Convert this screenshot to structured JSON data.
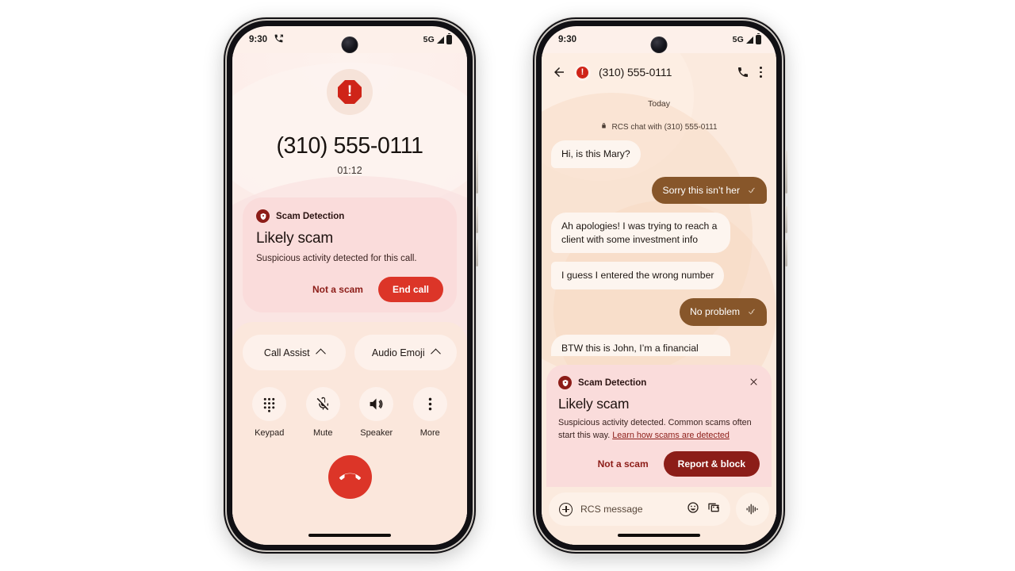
{
  "call_phone": {
    "status_bar": {
      "time": "9:30",
      "call_icon": "phone-in-talk-icon",
      "network": "5G",
      "signal_icon": "signal-bars-icon",
      "battery_icon": "battery-icon"
    },
    "caller": {
      "avatar_icon": "scam-octagon-icon",
      "number": "(310) 555-0111",
      "timer": "01:12"
    },
    "scam_card": {
      "badge_icon": "scam-shield-icon",
      "label": "Scam Detection",
      "title": "Likely scam",
      "body": "Suspicious activity detected for this call.",
      "secondary_action": "Not a scam",
      "primary_action": "End call",
      "bg_color": "#fadcdb",
      "primary_color": "#dc3528"
    },
    "assist_chips": [
      {
        "label": "Call Assist",
        "icon": "chevron-up-icon"
      },
      {
        "label": "Audio Emoji",
        "icon": "chevron-up-icon"
      }
    ],
    "controls": [
      {
        "label": "Keypad",
        "icon": "dialpad-icon"
      },
      {
        "label": "Mute",
        "icon": "mic-off-icon"
      },
      {
        "label": "Speaker",
        "icon": "speaker-icon"
      },
      {
        "label": "More",
        "icon": "more-vertical-icon"
      }
    ],
    "end_call": {
      "icon": "call-end-icon",
      "color": "#dc3528"
    }
  },
  "chat_phone": {
    "status_bar": {
      "time": "9:30",
      "network": "5G",
      "signal_icon": "signal-bars-icon",
      "battery_icon": "battery-icon"
    },
    "header": {
      "back_icon": "back-arrow-icon",
      "avatar_icon": "scam-alert-icon",
      "title": "(310) 555-0111",
      "call_icon": "phone-icon",
      "more_icon": "more-vertical-icon"
    },
    "day_label": "Today",
    "rcs_note": {
      "icon": "lock-icon",
      "text": "RCS chat with (310) 555-0111"
    },
    "messages": [
      {
        "side": "in",
        "text": "Hi, is this Mary?"
      },
      {
        "side": "out",
        "text": "Sorry this isn’t her",
        "receipt_icon": "double-check-icon"
      },
      {
        "side": "in",
        "text": "Ah apologies! I was trying to reach a client with some investment info"
      },
      {
        "side": "in",
        "text": "I guess I entered the wrong number"
      },
      {
        "side": "out",
        "text": "No problem",
        "receipt_icon": "double-check-icon"
      },
      {
        "side": "in",
        "text": "BTW this is John, I’m a financial advisor"
      }
    ],
    "scam_banner": {
      "badge_icon": "scam-shield-icon",
      "label": "Scam Detection",
      "close_icon": "close-icon",
      "title": "Likely scam",
      "body": "Suspicious activity detected. Common scams often start this way. ",
      "link": "Learn how scams are detected",
      "secondary_action": "Not a scam",
      "primary_action": "Report & block",
      "bg_color": "#fadcdb",
      "primary_color": "#8c1d18"
    },
    "composer": {
      "add_icon": "plus-circle-icon",
      "placeholder": "RCS message",
      "emoji_icon": "emoji-icon",
      "gallery_icon": "gallery-icon",
      "voice_icon": "voice-waveform-icon"
    }
  }
}
